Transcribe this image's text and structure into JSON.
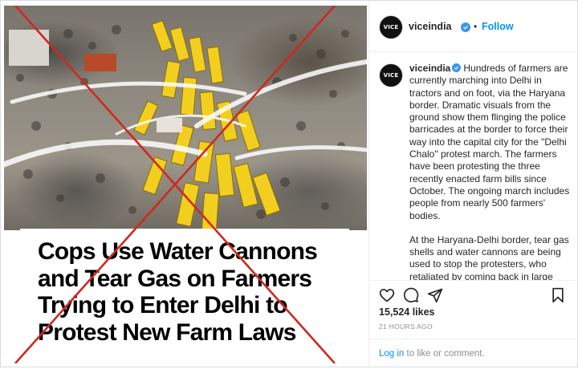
{
  "post": {
    "headline_lines": [
      "Cops Use Water Cannons",
      "and Tear Gas on Farmers",
      "Trying to Enter Delhi to",
      "Protest New Farm Laws"
    ]
  },
  "header": {
    "avatar_text": "VICE",
    "username": "viceindia",
    "separator": "•",
    "follow_label": "Follow"
  },
  "caption": {
    "username": "viceindia",
    "paragraph_1": "Hundreds of farmers are currently marching into Delhi in tractors and on foot, via the Haryana border. Dramatic visuals from the ground show them flinging the police barricades at the border to force their way into the capital city for the \"Delhi Chalo\" protest march. The farmers have been protesting the three recently enacted farm bills since October. The ongoing march includes people from nearly 500 farmers' bodies.",
    "paragraph_2": "At the Haryana-Delhi border, tear gas shells and water cannons are being used to stop the protesters, who retaliated by coming back in large numbers to clash with the police. According to news reports, the Delhi"
  },
  "actions": {
    "likes": "15,524 likes",
    "timestamp": "21 HOURS AGO",
    "login_link": "Log in",
    "login_rest": " to like or comment."
  },
  "icons": [
    "heart-icon",
    "comment-icon",
    "share-icon",
    "bookmark-icon",
    "verified-badge-icon"
  ],
  "colors": {
    "accent": "#0095f6",
    "verified": "#3897f0",
    "cross": "#d0281f",
    "barricade": "#f2cf1f"
  }
}
